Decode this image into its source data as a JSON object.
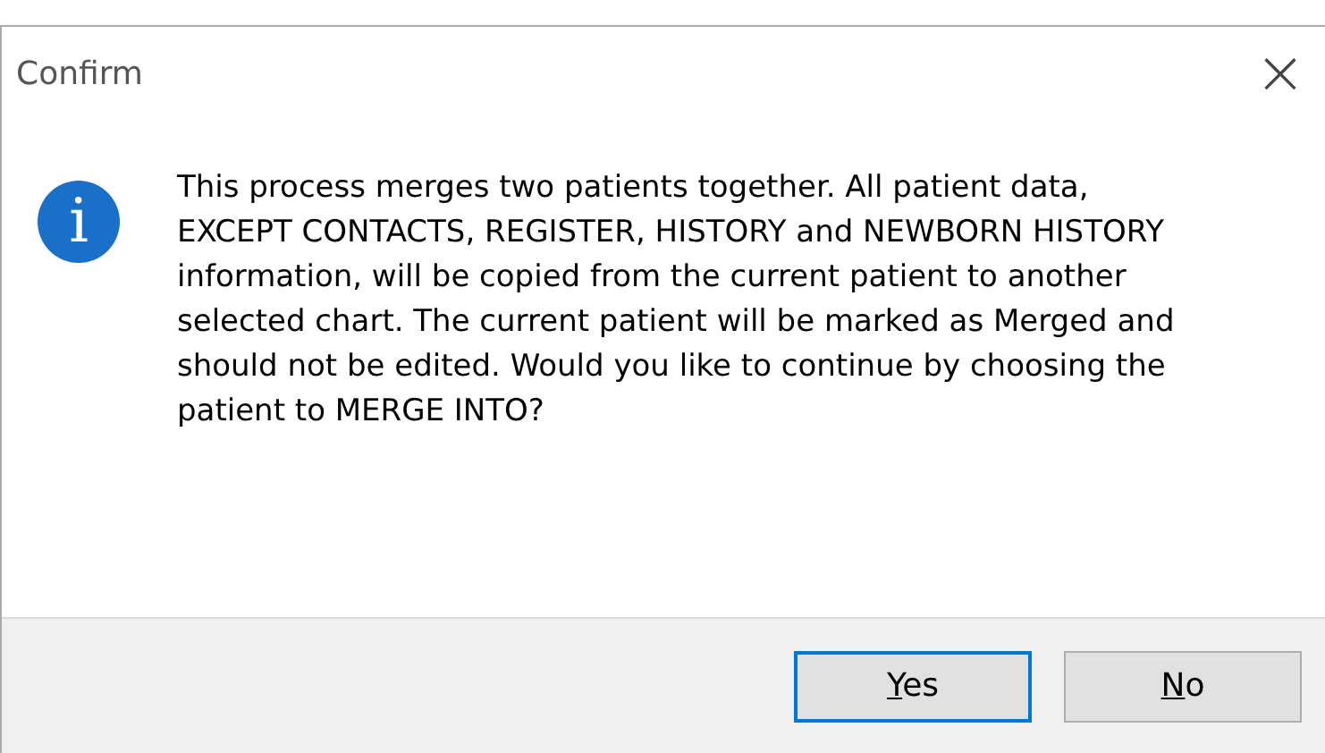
{
  "window": {
    "title": "Confirm",
    "close": "×"
  },
  "message": "This process merges two patients together. All patient data, EXCEPT CONTACTS, REGISTER, HISTORY and NEWBORN HISTORY information, will be copied from the current patient to another selected chart. The current patient will be marked as Merged and should not be edited. Would you like to continue by choosing the patient to MERGE INTO?",
  "icon": {
    "glyph": "i"
  },
  "buttons": [
    {
      "label": "Yes",
      "default": true,
      "mnemonic_first": true
    },
    {
      "label": "No",
      "default": false,
      "mnemonic_first": true
    }
  ]
}
